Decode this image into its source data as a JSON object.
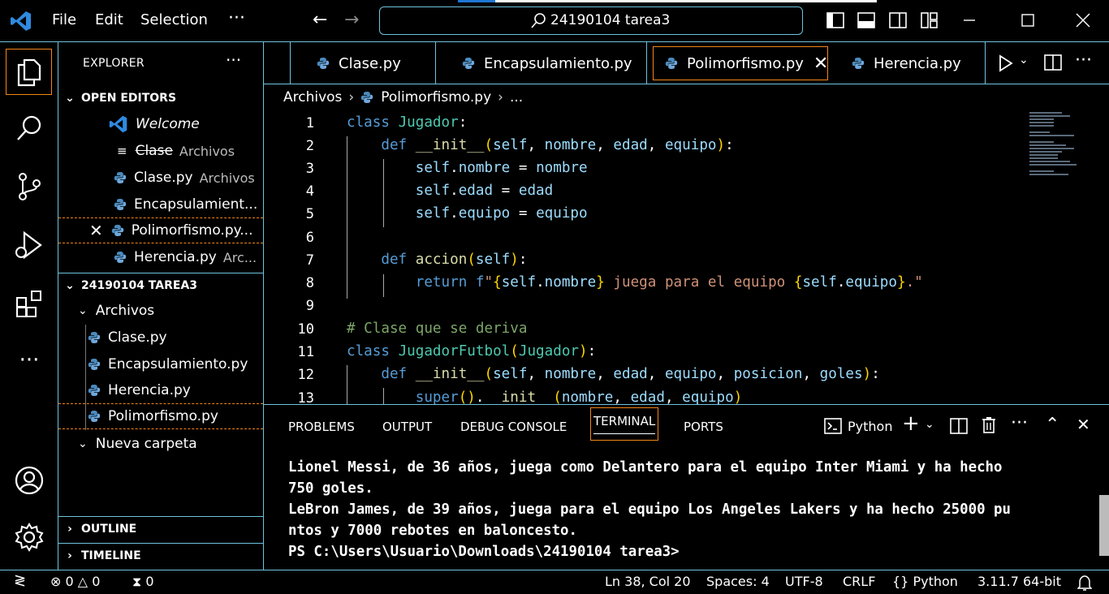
{
  "titlebar": {
    "menu": [
      "File",
      "Edit",
      "Selection"
    ],
    "more": "···",
    "search_label": "24190104 tarea3"
  },
  "explorer": {
    "title": "EXPLORER",
    "more": "···",
    "open_editors": {
      "title": "OPEN EDITORS",
      "items": [
        {
          "label": "Welcome",
          "desc": ""
        },
        {
          "label": "Clase",
          "desc": "Archivos"
        },
        {
          "label": "Clase.py",
          "desc": "Archivos"
        },
        {
          "label": "Encapsulamient...",
          "desc": ""
        },
        {
          "label": "Polimorfismo.py...",
          "desc": ""
        },
        {
          "label": "Herencia.py",
          "desc": "Arc..."
        }
      ]
    },
    "workspace": {
      "title": "24190104 TAREA3",
      "folder": "Archivos",
      "files": [
        "Clase.py",
        "Encapsulamiento.py",
        "Herencia.py",
        "Polimorfismo.py"
      ],
      "folder2": "Nueva carpeta"
    },
    "outline": "OUTLINE",
    "timeline": "TIMELINE"
  },
  "tabs": [
    {
      "label": "Clase.py"
    },
    {
      "label": "Encapsulamiento.py"
    },
    {
      "label": "Polimorfismo.py"
    },
    {
      "label": "Herencia.py"
    }
  ],
  "breadcrumb": [
    "Archivos",
    "Polimorfismo.py",
    "..."
  ],
  "code": {
    "line_numbers": [
      "1",
      "2",
      "3",
      "4",
      "5",
      "6",
      "7",
      "8",
      "9",
      "10",
      "11",
      "12",
      "13"
    ]
  },
  "panel": {
    "tabs": [
      "PROBLEMS",
      "OUTPUT",
      "DEBUG CONSOLE",
      "TERMINAL",
      "PORTS"
    ],
    "terminal_profile": "Python",
    "terminal_lines": [
      "Lionel Messi, de 36 años, juega como Delantero para el equipo Inter Miami y ha hecho",
      "750 goles.",
      "LeBron James, de 39 años, juega para el equipo Los Angeles Lakers y ha hecho 25000 pu",
      "ntos y 7000 rebotes en baloncesto.",
      "PS C:\\Users\\Usuario\\Downloads\\24190104 tarea3>"
    ]
  },
  "statusbar": {
    "errors": "0",
    "warnings": "0",
    "ports": "0",
    "position": "Ln 38, Col 20",
    "spaces": "Spaces: 4",
    "encoding": "UTF-8",
    "eol": "CRLF",
    "language": "Python",
    "interpreter": "3.11.7 64-bit"
  }
}
